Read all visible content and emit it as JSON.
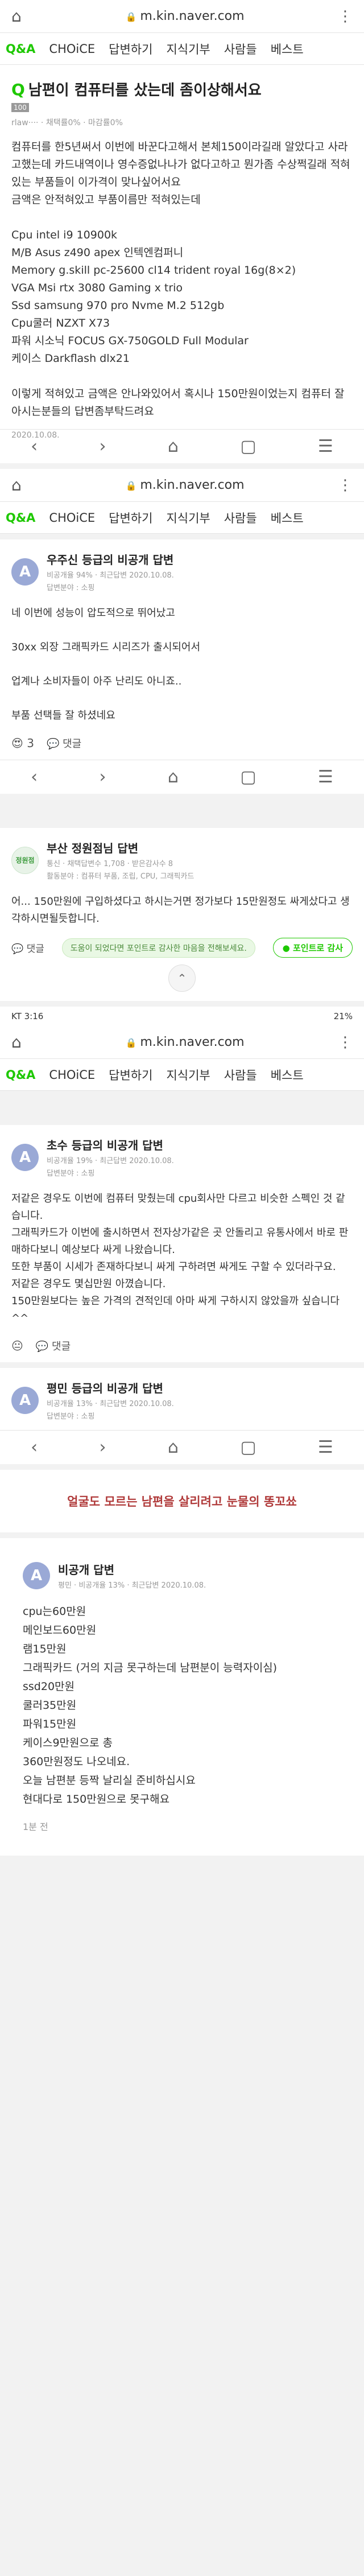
{
  "browser": {
    "url": "m.kin.naver.com"
  },
  "nav": {
    "items": [
      "Q&A",
      "CHOiCE",
      "답변하기",
      "지식기부",
      "사람들",
      "베스트"
    ]
  },
  "question": {
    "title": "남편이 컴퓨터를 샀는데 좀이상해서요",
    "badge": "100",
    "meta": "rlaw···· · 채택률0% · 마감률0%",
    "lines": [
      "컴퓨터를 한5년써서 이번에 바꾼다고해서 본체150이라길래 알았다고 사라고했는데 카드내역이나 영수증없나나가 없다고하고 뭔가좀 수상쩍길래 적혀있는 부품들이 이가격이 맞나싶어서요",
      "금액은 안적혀있고 부품이름만 적혀있는데",
      "",
      "Cpu intel i9 10900k",
      "M/B Asus z490 apex 인텍엔컴퍼니",
      "Memory g.skill pc-25600 cl14 trident royal 16g(8×2)",
      "VGA Msi rtx 3080 Gaming x trio",
      "Ssd samsung 970 pro Nvme M.2 512gb",
      "Cpu쿨러 NZXT X73",
      "파워 시소닉 FOCUS GX-750GOLD Full Modular",
      "케이스 Darkflash dlx21",
      "",
      "이렇게 적혀있고 금액은 안나와있어서 혹시나 150만원이었는지 컴퓨터 잘아시는분들의 답변좀부탁드려요"
    ],
    "date": "2020.10.08."
  },
  "answers": [
    {
      "name": "우주신 등급의 비공개 답변",
      "stats": "비공개율 94% · 최근답변 2020.10.08.",
      "field": "답변분야 : 소핑",
      "lines": [
        "네 이번에 성능이 압도적으로 뛰어났고",
        "",
        "30xx 외장 그래픽카드 시리즈가 출시되어서",
        "",
        "업계나 소비자들이 아주 난리도 아니죠..",
        "",
        "부품 선택들 잘 하셨네요"
      ],
      "reactions": "3",
      "comment": "댓글"
    },
    {
      "name": "부산 정원점님 답변",
      "stats": "통신 · 채택답변수 1,708 · 받은감사수 8",
      "field": "활동분야 : 컴퓨터 부품, 조립, CPU, 그래픽카드",
      "avatar": "정원점",
      "lines": [
        "어... 150만원에 구입하셨다고 하시는거면 정가보다 15만원정도 싸게샀다고 생각하시면될듯합니다."
      ],
      "tip": "도움이 되었다면 포인트로 감사한 마음을 전해보세요.",
      "thanks": "포인트로 감사",
      "comment": "댓글"
    },
    {
      "name": "초수 등급의 비공개 답변",
      "stats": "비공개율 19% · 최근답변 2020.10.08.",
      "field": "답변분야 : 소핑",
      "lines": [
        "저같은 경우도 이번에 컴퓨터 맞췄는데 cpu회사만 다르고 비슷한 스펙인 것 같습니다.",
        "그래픽카드가 이번에 출시하면서 전자상가같은 곳 안돌리고 유통사에서 바로 판매하다보니 예상보다 싸게 나왔습니다.",
        "또한 부품이 시세가 존재하다보니 싸게 구하려면 싸게도 구할 수 있더라구요.",
        "저같은 경우도 몇십만원 아꼈습니다.",
        "150만원보다는 높은 가격의 견적인데 아마 싸게 구하시지 않았을까 싶습니다^^"
      ],
      "reactions": "",
      "comment": "댓글"
    },
    {
      "name": "평민 등급의 비공개 답변",
      "stats": "비공개율 13% · 최근답변 2020.10.08.",
      "field": "답변분야 : 소핑"
    }
  ],
  "statusbar": {
    "left": "KT 3:16",
    "right": "21%"
  },
  "banner": "얼굴도 모르는 남편을 살리려고 눈물의 똥꼬쑈",
  "final": {
    "name": "비공개 답변",
    "stats": "평민 · 비공개율 13% · 최근답변 2020.10.08.",
    "lines": [
      "cpu는60만원",
      "메인보드60만원",
      "램15만원",
      "그래픽카드 (거의 지금 못구하는데 남편분이 능력자이심)",
      "ssd20만원",
      "쿨러35만원",
      "파워15만원",
      "케이스9만원으로 총",
      "360만원정도 나오네요.",
      "오늘 남편분 등짝 날리실 준비하십시요",
      "현대다로 150만원으로 못구해요"
    ],
    "date": "1분 전"
  }
}
